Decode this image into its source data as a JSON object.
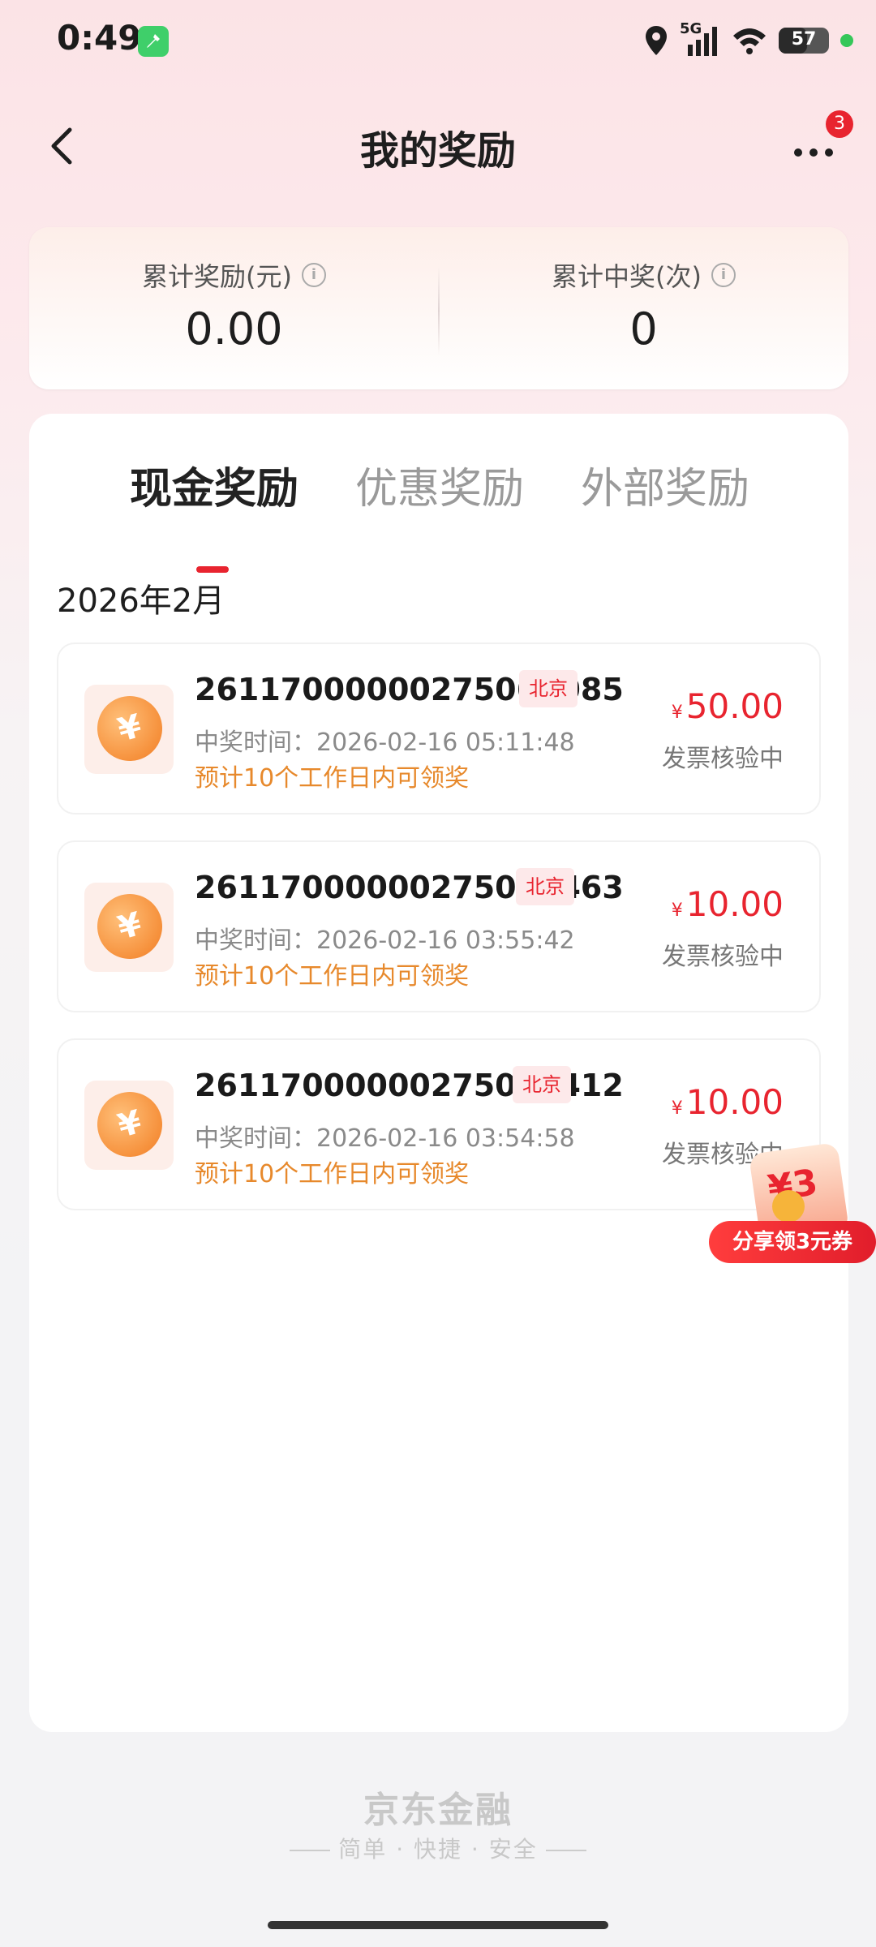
{
  "status_bar": {
    "time": "0:49",
    "network": "5G",
    "battery": "57",
    "battery_level": 0.57
  },
  "header": {
    "title": "我的奖励",
    "more_badge": "3"
  },
  "summary": {
    "total_reward_label": "累计奖励(元)",
    "total_reward_value": "0.00",
    "total_wins_label": "累计中奖(次)",
    "total_wins_value": "0"
  },
  "tabs": [
    {
      "label": "现金奖励",
      "active": true
    },
    {
      "label": "优惠奖励",
      "active": false
    },
    {
      "label": "外部奖励",
      "active": false
    }
  ],
  "month": "2026年2月",
  "records": [
    {
      "id": "26117000000275062085",
      "city": "北京",
      "time": "中奖时间：2026-02-16 05:11:48",
      "note": "预计10个工作日内可领奖",
      "currency": "¥",
      "amount": "50.00",
      "status": "发票核验中"
    },
    {
      "id": "26117000000275018463",
      "city": "北京",
      "time": "中奖时间：2026-02-16 03:55:42",
      "note": "预计10个工作日内可领奖",
      "currency": "¥",
      "amount": "10.00",
      "status": "发票核验中"
    },
    {
      "id": "26117000000275018412",
      "city": "北京",
      "time": "中奖时间：2026-02-16 03:54:58",
      "note": "预计10个工作日内可领奖",
      "currency": "¥",
      "amount": "10.00",
      "status": "发票核验中"
    }
  ],
  "share_promo": {
    "coupon": "¥3",
    "label": "分享领3元券"
  },
  "footer": {
    "brand": "京东金融",
    "slogan": "简单 · 快捷 · 安全"
  },
  "colors": {
    "accent": "#e8242f",
    "note": "#e7892c"
  }
}
